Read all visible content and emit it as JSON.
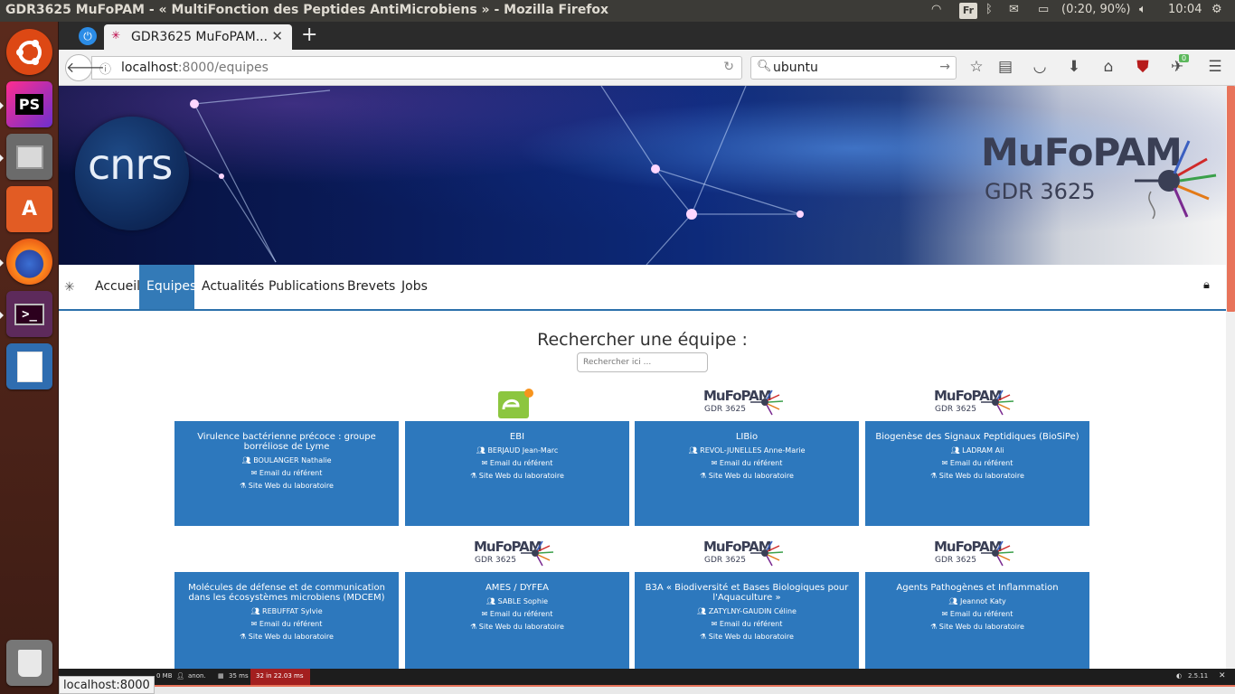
{
  "window": {
    "title": "GDR3625 MuFoPAM - « MultiFonction des Peptides AntiMicrobiens » - Mozilla Firefox",
    "keyboard": "Fr",
    "battery": "(0:20, 90%)",
    "clock": "10:04"
  },
  "launcher": {
    "items": [
      {
        "name": "ubuntu-dash-icon",
        "glyph": "◉"
      },
      {
        "name": "phpstorm-icon",
        "glyph": "PS"
      },
      {
        "name": "files-icon",
        "glyph": "▭"
      },
      {
        "name": "software-center-icon",
        "glyph": "A"
      },
      {
        "name": "firefox-icon",
        "glyph": "●"
      },
      {
        "name": "terminal-icon",
        "glyph": ">_"
      },
      {
        "name": "libreoffice-impress-icon",
        "glyph": "▤"
      },
      {
        "name": "trash-icon",
        "glyph": "🗑"
      }
    ]
  },
  "browser": {
    "tab_title": "GDR3625 MuFoPAM...",
    "tab_close": "✕",
    "new_tab": "+",
    "url_host": "localhost",
    "url_rest": ":8000/equipes",
    "search_query": "ubuntu",
    "addon_badge": "0"
  },
  "site": {
    "cnrs_logo_text": "cnrs",
    "mufopam_logo_line1": "MuFoPAM",
    "mufopam_logo_line2": "GDR 3625",
    "menu": [
      "Accueil",
      "Equipes",
      "Actualités",
      "Publications",
      "Brevets",
      "Jobs"
    ],
    "search_title": "Rechercher une équipe :",
    "search_placeholder": "Rechercher ici ..."
  },
  "teams": [
    {
      "name": "Virulence bactérienne précoce : groupe borréliose de Lyme",
      "referent": "BOULANGER Nathalie",
      "email": "Email du référent",
      "site": "Site Web du laboratoire",
      "logo": "none"
    },
    {
      "name": "EBI",
      "referent": "BERJAUD Jean-Marc",
      "email": "Email du référent",
      "site": "Site Web du laboratoire",
      "logo": "ebi"
    },
    {
      "name": "LIBio",
      "referent": "REVOL-JUNELLES Anne-Marie",
      "email": "Email du référent",
      "site": "Site Web du laboratoire",
      "logo": "mufopam"
    },
    {
      "name": "Biogenèse des Signaux Peptidiques (BioSiPe)",
      "referent": "LADRAM Ali",
      "email": "Email du référent",
      "site": "Site Web du laboratoire",
      "logo": "mufopam"
    },
    {
      "name": "Molécules de défense et de communication dans les écosystèmes microbiens (MDCEM)",
      "referent": "REBUFFAT Sylvie",
      "email": "Email du référent",
      "site": "Site Web du laboratoire",
      "logo": "none"
    },
    {
      "name": "AMES / DYFEA",
      "referent": "SABLE Sophie",
      "email": "Email du référent",
      "site": "Site Web du laboratoire",
      "logo": "mufopam"
    },
    {
      "name": "B3A « Biodiversité et Bases Biologiques pour l'Aquaculture »",
      "referent": "ZATYLNY-GAUDIN Céline",
      "email": "Email du référent",
      "site": "Site Web du laboratoire",
      "logo": "mufopam"
    },
    {
      "name": "Agents Pathogènes et Inflammation",
      "referent": "Jeannot Katy",
      "email": "Email du référent",
      "site": "Site Web du laboratoire",
      "logo": "mufopam"
    }
  ],
  "mini_logo": {
    "line1": "MuFoPAM",
    "line2": "GDR 3625"
  },
  "debugbar": {
    "memory": "0 MB",
    "user": "anon.",
    "time": "35 ms",
    "queries": "32 in 22.03 ms",
    "version": "2.5.11"
  },
  "statusline": "localhost:8000"
}
